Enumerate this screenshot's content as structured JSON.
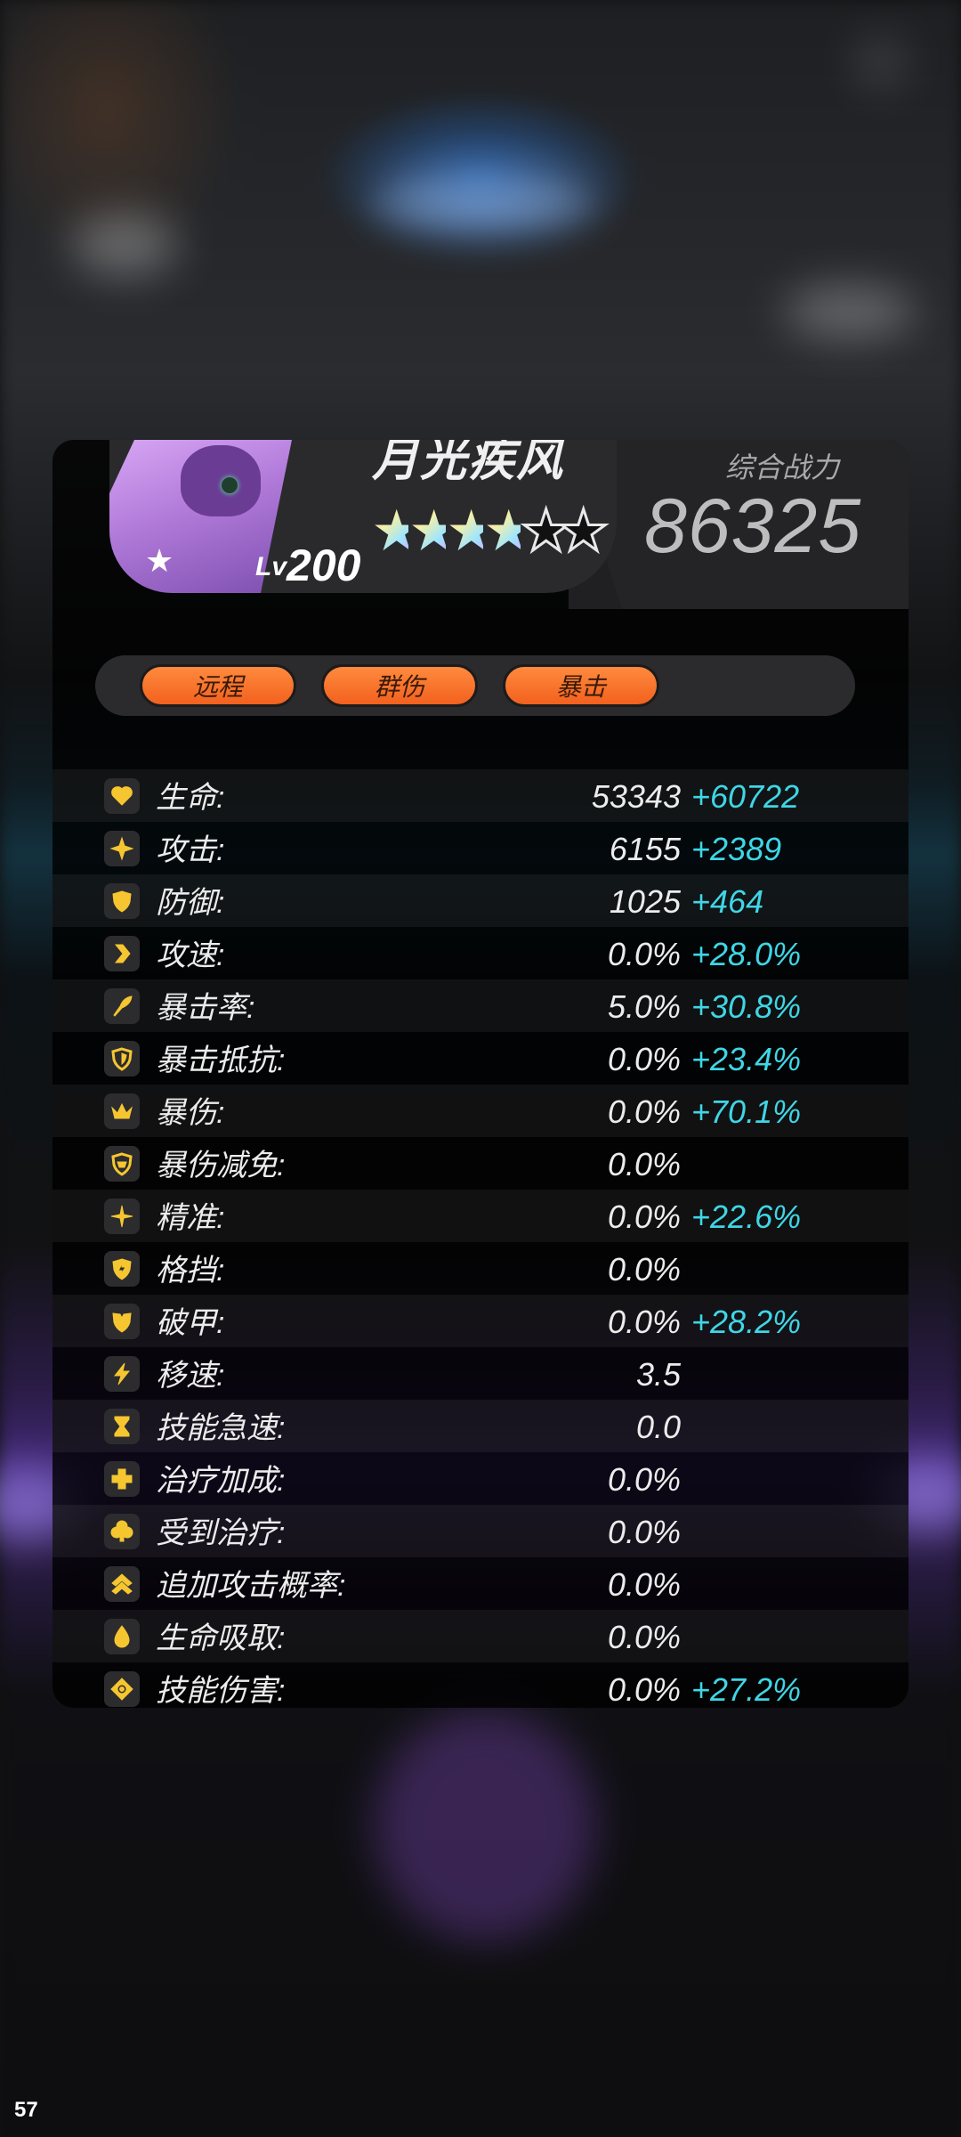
{
  "hero": {
    "name": "月光疾风",
    "level_prefix": "Lv",
    "level": "200",
    "stars_filled": 4,
    "stars_total": 6
  },
  "power": {
    "label": "综合战力",
    "value": "86325"
  },
  "tags": [
    "远程",
    "群伤",
    "暴击"
  ],
  "stats": [
    {
      "label": "生命:",
      "base": "53343",
      "bonus": "+60722",
      "icon": "heart-icon"
    },
    {
      "label": "攻击:",
      "base": "6155",
      "bonus": "+2389",
      "icon": "sparkle-icon"
    },
    {
      "label": "防御:",
      "base": "1025",
      "bonus": "+464",
      "icon": "shield-icon"
    },
    {
      "label": "攻速:",
      "base": "0.0%",
      "bonus": "+28.0%",
      "icon": "chevron-right-icon"
    },
    {
      "label": "暴击率:",
      "base": "5.0%",
      "bonus": "+30.8%",
      "icon": "feather-icon"
    },
    {
      "label": "暴击抵抗:",
      "base": "0.0%",
      "bonus": "+23.4%",
      "icon": "shield-outline-icon"
    },
    {
      "label": "暴伤:",
      "base": "0.0%",
      "bonus": "+70.1%",
      "icon": "crown-icon"
    },
    {
      "label": "暴伤减免:",
      "base": "0.0%",
      "bonus": "",
      "icon": "shield-emblem-icon"
    },
    {
      "label": "精准:",
      "base": "0.0%",
      "bonus": "+22.6%",
      "icon": "crosshair-icon"
    },
    {
      "label": "格挡:",
      "base": "0.0%",
      "bonus": "",
      "icon": "shield-bolt-icon"
    },
    {
      "label": "破甲:",
      "base": "0.0%",
      "bonus": "+28.2%",
      "icon": "broken-shield-icon"
    },
    {
      "label": "移速:",
      "base": "3.5",
      "bonus": "",
      "icon": "lightning-icon"
    },
    {
      "label": "技能急速:",
      "base": "0.0",
      "bonus": "",
      "icon": "hourglass-icon"
    },
    {
      "label": "治疗加成:",
      "base": "0.0%",
      "bonus": "",
      "icon": "plus-icon"
    },
    {
      "label": "受到治疗:",
      "base": "0.0%",
      "bonus": "",
      "icon": "clover-icon"
    },
    {
      "label": "追加攻击概率:",
      "base": "0.0%",
      "bonus": "",
      "icon": "double-chevron-up-icon"
    },
    {
      "label": "生命吸取:",
      "base": "0.0%",
      "bonus": "",
      "icon": "drop-icon"
    },
    {
      "label": "技能伤害:",
      "base": "0.0%",
      "bonus": "+27.2%",
      "icon": "target-icon"
    }
  ],
  "colors": {
    "icon": "#f6c631",
    "bonus": "#3fd6e6",
    "tag": "#f2611f"
  },
  "fps": "57"
}
